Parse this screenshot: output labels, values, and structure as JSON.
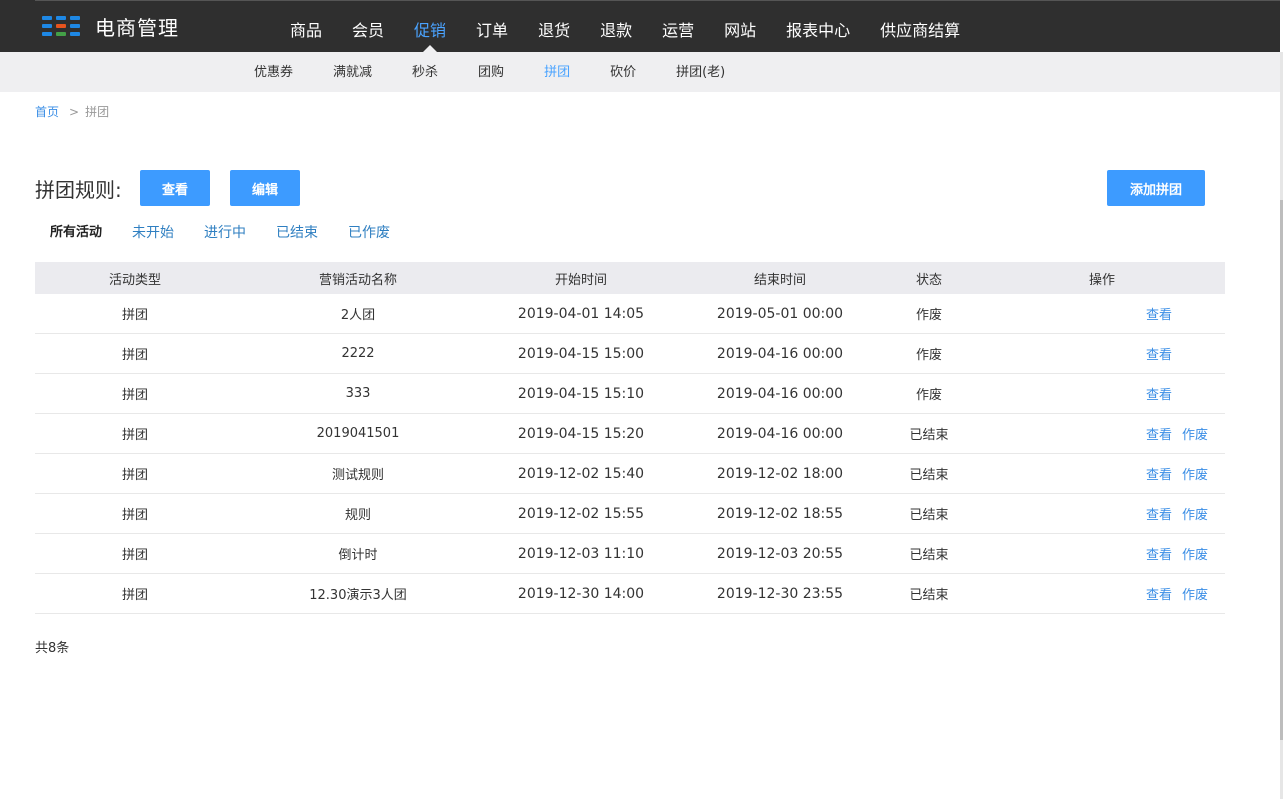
{
  "header": {
    "logo_text": "电商管理",
    "logo_colors": [
      "#1e88e5",
      "#1e88e5",
      "#1e88e5",
      "#1e88e5",
      "#e8541e",
      "#1e88e5",
      "#1e88e5",
      "#43a047",
      "#1e88e5"
    ],
    "nav": [
      {
        "label": "商品",
        "active": false
      },
      {
        "label": "会员",
        "active": false
      },
      {
        "label": "促销",
        "active": true
      },
      {
        "label": "订单",
        "active": false
      },
      {
        "label": "退货",
        "active": false
      },
      {
        "label": "退款",
        "active": false
      },
      {
        "label": "运营",
        "active": false
      },
      {
        "label": "网站",
        "active": false
      },
      {
        "label": "报表中心",
        "active": false
      },
      {
        "label": "供应商结算",
        "active": false
      }
    ]
  },
  "subnav": [
    {
      "label": "优惠券",
      "active": false
    },
    {
      "label": "满就减",
      "active": false
    },
    {
      "label": "秒杀",
      "active": false
    },
    {
      "label": "团购",
      "active": false
    },
    {
      "label": "拼团",
      "active": true
    },
    {
      "label": "砍价",
      "active": false
    },
    {
      "label": "拼团(老)",
      "active": false
    }
  ],
  "breadcrumb": {
    "home": "首页",
    "separator": ">",
    "current": "拼团"
  },
  "rules": {
    "title": "拼团规则:",
    "view_label": "查看",
    "edit_label": "编辑",
    "add_label": "添加拼团"
  },
  "filters": [
    {
      "label": "所有活动",
      "active": true
    },
    {
      "label": "未开始",
      "active": false
    },
    {
      "label": "进行中",
      "active": false
    },
    {
      "label": "已结束",
      "active": false
    },
    {
      "label": "已作废",
      "active": false
    }
  ],
  "table": {
    "columns": [
      "活动类型",
      "营销活动名称",
      "开始时间",
      "结束时间",
      "状态",
      "操作"
    ],
    "rows": [
      {
        "type": "拼团",
        "name": "2人团",
        "start": "2019-04-01 14:05",
        "end": "2019-05-01 00:00",
        "status": "作废",
        "actions": [
          "查看"
        ]
      },
      {
        "type": "拼团",
        "name": "2222",
        "start": "2019-04-15 15:00",
        "end": "2019-04-16 00:00",
        "status": "作废",
        "actions": [
          "查看"
        ]
      },
      {
        "type": "拼团",
        "name": "333",
        "start": "2019-04-15 15:10",
        "end": "2019-04-16 00:00",
        "status": "作废",
        "actions": [
          "查看"
        ]
      },
      {
        "type": "拼团",
        "name": "2019041501",
        "start": "2019-04-15 15:20",
        "end": "2019-04-16 00:00",
        "status": "已结束",
        "actions": [
          "查看",
          "作废"
        ]
      },
      {
        "type": "拼团",
        "name": "测试规则",
        "start": "2019-12-02 15:40",
        "end": "2019-12-02 18:00",
        "status": "已结束",
        "actions": [
          "查看",
          "作废"
        ]
      },
      {
        "type": "拼团",
        "name": "规则",
        "start": "2019-12-02 15:55",
        "end": "2019-12-02 18:55",
        "status": "已结束",
        "actions": [
          "查看",
          "作废"
        ]
      },
      {
        "type": "拼团",
        "name": "倒计时",
        "start": "2019-12-03 11:10",
        "end": "2019-12-03 20:55",
        "status": "已结束",
        "actions": [
          "查看",
          "作废"
        ]
      },
      {
        "type": "拼团",
        "name": "12.30演示3人团",
        "start": "2019-12-30 14:00",
        "end": "2019-12-30 23:55",
        "status": "已结束",
        "actions": [
          "查看",
          "作废"
        ]
      }
    ]
  },
  "footer": {
    "total": "共8条"
  }
}
